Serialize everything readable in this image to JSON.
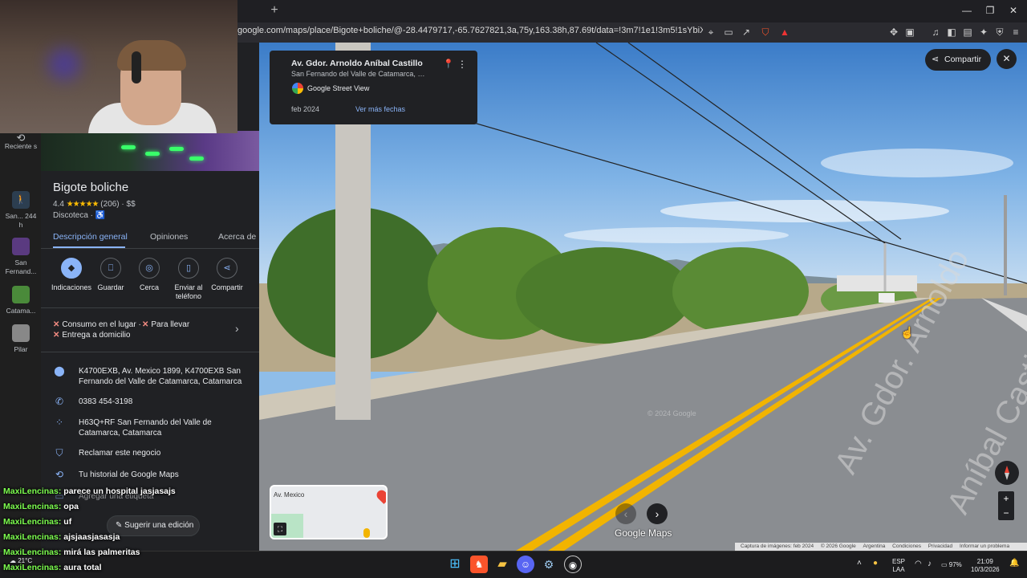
{
  "browser": {
    "new_tab_glyph": "+",
    "url": "google.com/maps/place/Bigote+boliche/@-28.4479717,-65.7627821,3a,75y,163.38h,87.69t/data=!3m7!1e1!3m5!1sYbiXElmDHz54iYDausN...",
    "window_buttons": [
      "—",
      "❐",
      "✕"
    ]
  },
  "rail": {
    "items": [
      {
        "label": "Reciente s"
      },
      {
        "label": "San... 244 h"
      },
      {
        "label": "San Fernand..."
      },
      {
        "label": "Catama..."
      },
      {
        "label": "Pilar"
      }
    ]
  },
  "place": {
    "name": "Bigote boliche",
    "rating": "4.4",
    "stars": "★★★★★",
    "reviews": "(206) · $$",
    "category": "Discoteca · ♿",
    "tabs": [
      "Descripción general",
      "Opiniones",
      "Acerca de"
    ],
    "actions": [
      "Indicaciones",
      "Guardar",
      "Cerca",
      "Enviar al teléfono",
      "Compartir"
    ],
    "services": {
      "dine_in": "Consumo en el lugar ·",
      "takeout": "Para llevar",
      "delivery": "Entrega a domicilio"
    },
    "address": "K4700EXB, Av. Mexico 1899, K4700EXB San Fernando del Valle de Catamarca, Catamarca",
    "phone": "0383 454-3198",
    "plus_code": "H63Q+RF San Fernando del Valle de Catamarca, Catamarca",
    "claim": "Reclamar este negocio",
    "history": "Tu historial de Google Maps",
    "label_add": "Agregar una etiqueta",
    "suggest_edit": "Sugerir una edición"
  },
  "streetview": {
    "title": "Av. Gdor. Arnoldo Aníbal Castillo",
    "subtitle": "San Fernando del Valle de Catamarca, Cat...",
    "source": "Google Street View",
    "date": "feb 2024",
    "more_dates": "Ver más fechas",
    "share": "Compartir",
    "road_marking_1": "Av. Gdor. Arnoldo",
    "road_marking_2": "Aníbal Castillo",
    "watermark": "© 2024 Google",
    "logo": "Google Maps",
    "minimap_label": "Av. Mexico",
    "attribution": [
      "Captura de imágenes: feb 2024",
      "© 2026 Google",
      "Argentina",
      "Condiciones",
      "Privacidad",
      "Informar un problema"
    ]
  },
  "chat": [
    {
      "user": "MaxiLencinas:",
      "msg": "parece un hospital jasjasajs"
    },
    {
      "user": "MaxiLencinas:",
      "msg": "opa"
    },
    {
      "user": "MaxiLencinas:",
      "msg": "uf"
    },
    {
      "user": "MaxiLencinas:",
      "msg": "ajsjaasjasasja"
    },
    {
      "user": "MaxiLencinas:",
      "msg": "mirá las palmeritas"
    },
    {
      "user": "MaxiLencinas:",
      "msg": "aura total"
    }
  ],
  "taskbar": {
    "weather": "21°C",
    "lang_1": "ESP",
    "lang_2": "LAA",
    "battery": "97%",
    "time": "21:09",
    "date": "10/3/2026"
  },
  "colors": {
    "accent": "#8ab4f8",
    "chat_user": "#7dff4f"
  }
}
